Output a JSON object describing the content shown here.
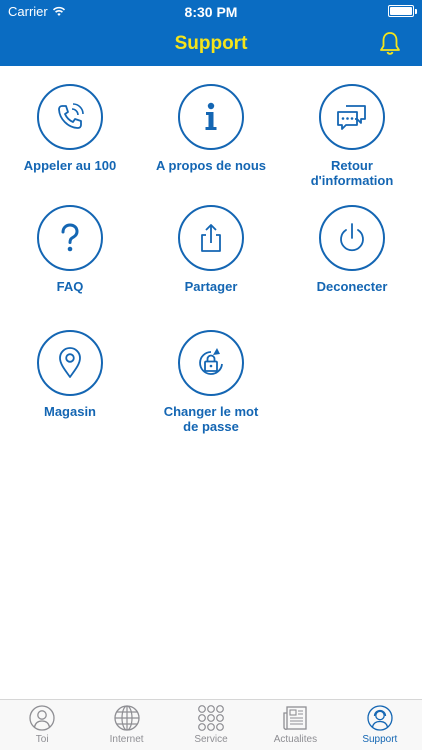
{
  "status_bar": {
    "carrier": "Carrier",
    "time": "8:30 PM"
  },
  "nav": {
    "title": "Support"
  },
  "colors": {
    "brand": "#0a6cc2",
    "title": "#f5e41b",
    "accent": "#1466b3",
    "inactive": "#8e8e93"
  },
  "menu": {
    "items": [
      {
        "label": "Appeler au 100",
        "icon": "phone-icon"
      },
      {
        "label": "A propos de nous",
        "icon": "info-icon"
      },
      {
        "label": "Retour d'information",
        "icon": "feedback-icon"
      },
      {
        "label": "FAQ",
        "icon": "question-icon"
      },
      {
        "label": "Partager",
        "icon": "share-icon"
      },
      {
        "label": "Deconecter",
        "icon": "power-icon"
      },
      {
        "label": "Magasin",
        "icon": "location-pin-icon"
      },
      {
        "label": "Changer le mot de passe",
        "icon": "lock-refresh-icon"
      }
    ]
  },
  "tabs": [
    {
      "label": "Toi",
      "icon": "user-icon"
    },
    {
      "label": "Internet",
      "icon": "globe-icon"
    },
    {
      "label": "Service",
      "icon": "grid-dots-icon"
    },
    {
      "label": "Actualites",
      "icon": "newspaper-icon"
    },
    {
      "label": "Support",
      "icon": "support-agent-icon",
      "active": true
    }
  ]
}
